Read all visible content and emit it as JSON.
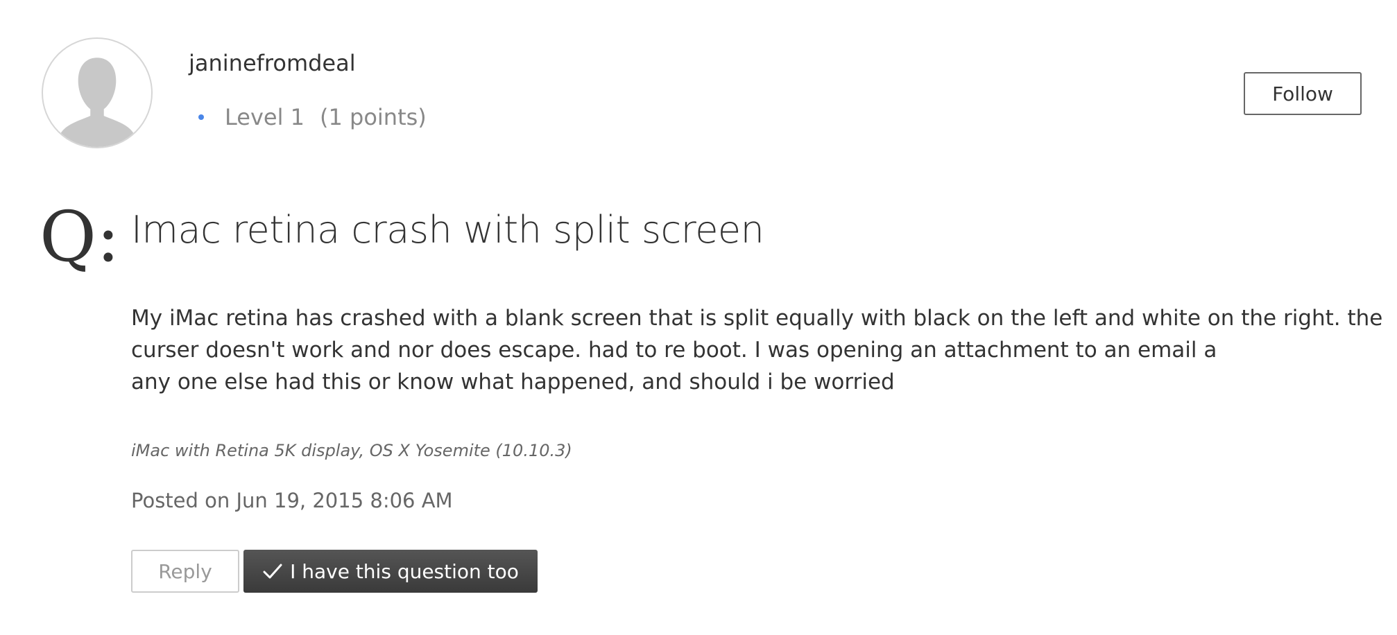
{
  "author": {
    "username": "janinefromdeal",
    "level": "Level 1",
    "points": "(1 points)",
    "avatar_icon": "default-user-silhouette-icon"
  },
  "follow_button": {
    "label": "Follow"
  },
  "question": {
    "marker": "Q:",
    "title": "Imac retina crash with split screen",
    "body_lines": [
      "My iMac retina has crashed with a blank screen that is split equally with black on the left and white on the right. the",
      "curser doesn't work and nor does escape.  had to re boot. I was opening an attachment to an email a",
      "any one else had this or know what happened, and should i be worried"
    ],
    "device_info": "iMac with Retina 5K display, OS X Yosemite (10.10.3)",
    "posted": "Posted on Jun 19, 2015 8:06 AM"
  },
  "actions": {
    "reply_label": "Reply",
    "question_too_label": "I have this question too",
    "question_too_icon": "checkmark-icon"
  },
  "colors": {
    "level_dot": "#4a86e8",
    "dark_button": "#444444"
  }
}
